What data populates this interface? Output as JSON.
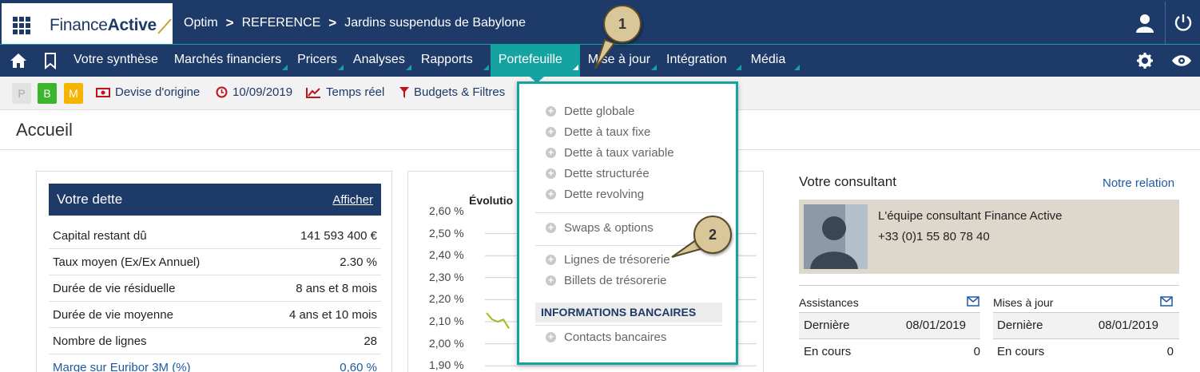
{
  "topbar": {
    "logo_text_1": "Finance",
    "logo_text_2": "Active",
    "breadcrumb": [
      "Optim",
      "REFERENCE",
      "Jardins suspendus de Babylone"
    ],
    "separator": ">"
  },
  "nav": {
    "items": [
      {
        "label": "Votre synthèse"
      },
      {
        "label": "Marchés financiers"
      },
      {
        "label": "Pricers"
      },
      {
        "label": "Analyses"
      },
      {
        "label": "Rapports"
      },
      {
        "label": "Portefeuille",
        "active": true
      },
      {
        "label": "Mise à jour"
      },
      {
        "label": "Intégration"
      },
      {
        "label": "Média"
      }
    ]
  },
  "toolbar": {
    "badges": [
      {
        "label": "P",
        "color": "#e2e2e2",
        "text": "#aaaaaa"
      },
      {
        "label": "B",
        "color": "#3cb52e",
        "text": "#ffffff"
      },
      {
        "label": "M",
        "color": "#f5b400",
        "text": "#ffffff"
      }
    ],
    "devise": "Devise d'origine",
    "date": "10/09/2019",
    "temps": "Temps réel",
    "budgets": "Budgets & Filtres"
  },
  "page": {
    "title": "Accueil"
  },
  "debt": {
    "title": "Votre dette",
    "action": "Afficher",
    "rows": [
      {
        "label": "Capital restant dû",
        "value": "141 593 400 €"
      },
      {
        "label": "Taux moyen (Ex/Ex Annuel)",
        "value": "2.30 %"
      },
      {
        "label": "Durée de vie résiduelle",
        "value": "8 ans et 8 mois"
      },
      {
        "label": "Durée de vie moyenne",
        "value": "4 ans et 10 mois"
      },
      {
        "label": "Nombre de lignes",
        "value": "28"
      },
      {
        "label": "Marge sur Euribor 3M (%)",
        "value": "0,60 %"
      }
    ]
  },
  "chart": {
    "title": "Évolutio",
    "yticks": [
      "2,60 %",
      "2,50 %",
      "2,40 %",
      "2,30 %",
      "2,20 %",
      "2,10 %",
      "2,00 %",
      "1,90 %"
    ]
  },
  "chart_data": {
    "type": "line",
    "title": "Évolutio",
    "ylim": [
      1.9,
      2.6
    ],
    "y_ticks": [
      "2,60 %",
      "2,50 %",
      "2,40 %",
      "2,30 %",
      "2,20 %",
      "2,10 %",
      "2,00 %",
      "1,90 %"
    ],
    "series": [
      {
        "values": [
          2.14,
          2.11,
          2.1,
          2.11,
          2.07
        ]
      }
    ],
    "grid": true,
    "colors": [
      "#9bbd1c"
    ]
  },
  "dropdown": {
    "items_1": [
      "Dette globale",
      "Dette à taux fixe",
      "Dette à taux variable",
      "Dette structurée",
      "Dette revolving"
    ],
    "items_2": [
      "Swaps & options"
    ],
    "items_3": [
      "Lignes de trésorerie",
      "Billets de trésorerie"
    ],
    "header": "INFORMATIONS BANCAIRES",
    "items_4": [
      "Contacts bancaires"
    ]
  },
  "callouts": [
    "1",
    "2"
  ],
  "consultant": {
    "title": "Votre consultant",
    "link": "Notre relation",
    "line1": "L'équipe consultant Finance Active",
    "line2": "+33 (0)1 55 80 78 40"
  },
  "assistances": {
    "title": "Assistances",
    "last_label": "Dernière",
    "last_value": "08/01/2019",
    "current_label": "En cours",
    "current_value": "0"
  },
  "mises": {
    "title": "Mises à jour",
    "last_label": "Dernière",
    "last_value": "08/01/2019",
    "current_label": "En cours",
    "current_value": "0"
  },
  "colors": {
    "navy": "#1e3a68",
    "teal": "#14a3a0",
    "red": "#c0121b"
  }
}
